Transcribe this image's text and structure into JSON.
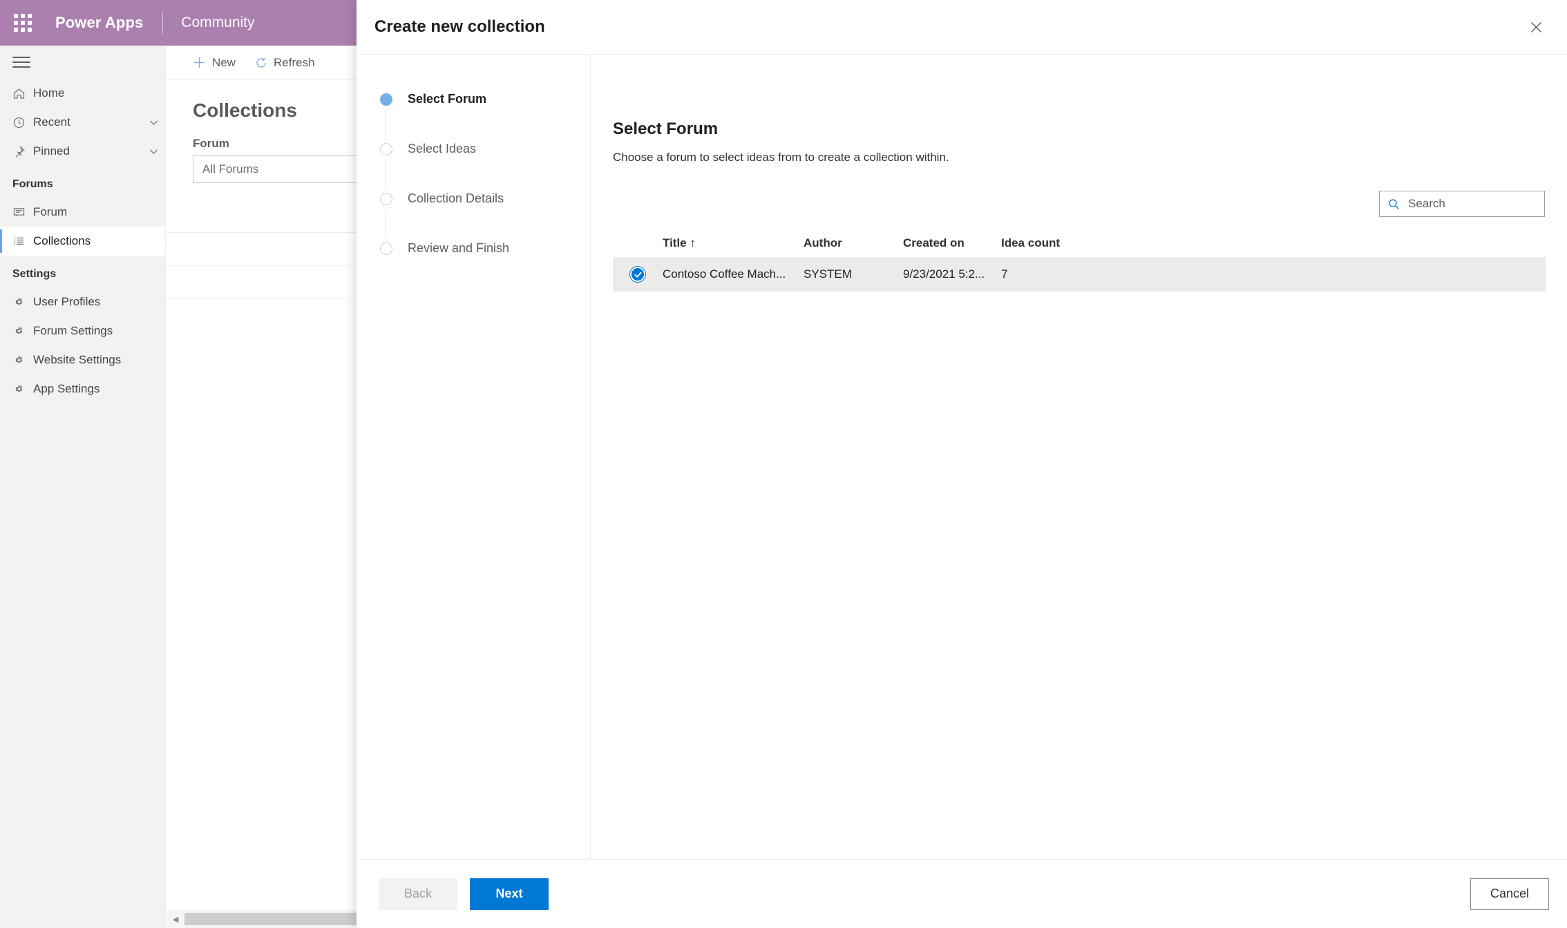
{
  "suite_bar": {
    "waffle_icon": "app-launcher-icon",
    "product": "Power Apps",
    "app": "Community",
    "background": "#ab7fae"
  },
  "left_nav": {
    "hamburger_icon": "hamburger-menu-icon",
    "items": [
      {
        "label": "Home",
        "icon": "home-icon",
        "chevron": false,
        "selected": false
      },
      {
        "label": "Recent",
        "icon": "clock-icon",
        "chevron": true,
        "selected": false
      },
      {
        "label": "Pinned",
        "icon": "pin-icon",
        "chevron": true,
        "selected": false
      }
    ],
    "groups": [
      {
        "title": "Forums",
        "items": [
          {
            "label": "Forum",
            "icon": "forum-icon",
            "selected": false
          },
          {
            "label": "Collections",
            "icon": "collections-list-icon",
            "selected": true
          }
        ]
      },
      {
        "title": "Settings",
        "items": [
          {
            "label": "User Profiles",
            "icon": "gear-icon",
            "selected": false
          },
          {
            "label": "Forum Settings",
            "icon": "gear-icon",
            "selected": false
          },
          {
            "label": "Website Settings",
            "icon": "gear-icon",
            "selected": false
          },
          {
            "label": "App Settings",
            "icon": "gear-icon",
            "selected": false
          }
        ]
      }
    ],
    "accent": "#6ba5e7"
  },
  "command_bar": {
    "commands": [
      {
        "label": "New",
        "icon": "plus-icon"
      },
      {
        "label": "Refresh",
        "icon": "refresh-icon"
      }
    ]
  },
  "page": {
    "title": "Collections",
    "filter_label": "Forum",
    "filter_value": "All Forums",
    "grid_column": "Title"
  },
  "dialog": {
    "title": "Create new collection",
    "close_icon": "close-icon",
    "steps": [
      {
        "label": "Select Forum",
        "state": "active"
      },
      {
        "label": "Select Ideas",
        "state": "pending"
      },
      {
        "label": "Collection Details",
        "state": "pending"
      },
      {
        "label": "Review and Finish",
        "state": "pending"
      }
    ],
    "pane": {
      "heading": "Select Forum",
      "description": "Choose a forum to select ideas from to create a collection within."
    },
    "search": {
      "icon": "search-icon",
      "value": "",
      "placeholder": "Search"
    },
    "table": {
      "columns": [
        {
          "key": "title",
          "label": "Title",
          "sort": "↑"
        },
        {
          "key": "author",
          "label": "Author",
          "sort": ""
        },
        {
          "key": "created",
          "label": "Created on",
          "sort": ""
        },
        {
          "key": "count",
          "label": "Idea count",
          "sort": ""
        }
      ],
      "rows": [
        {
          "selected": true,
          "check_icon": "check-circle-icon",
          "title": "Contoso Coffee Mach...",
          "author": "SYSTEM",
          "created": "9/23/2021 5:2...",
          "count": "7"
        }
      ]
    },
    "footer": {
      "back_label": "Back",
      "next_label": "Next",
      "cancel_label": "Cancel",
      "primary_color": "#0078d4"
    }
  }
}
